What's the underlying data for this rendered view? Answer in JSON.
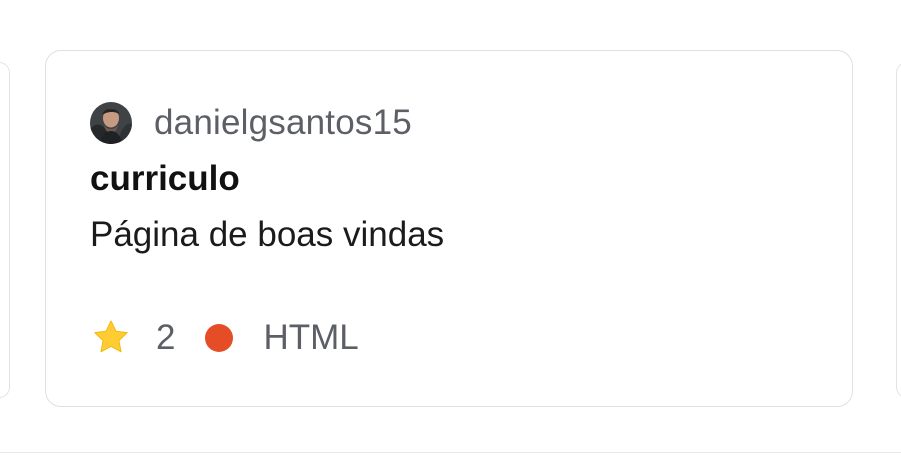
{
  "card": {
    "owner": {
      "username": "danielgsantos15",
      "avatar": "avatar"
    },
    "repository": {
      "name": "curriculo",
      "description": "Página de boas vindas"
    },
    "stats": {
      "star_icon": "star-icon",
      "stars": "2",
      "language": "HTML",
      "language_color": "#e44d26"
    }
  }
}
